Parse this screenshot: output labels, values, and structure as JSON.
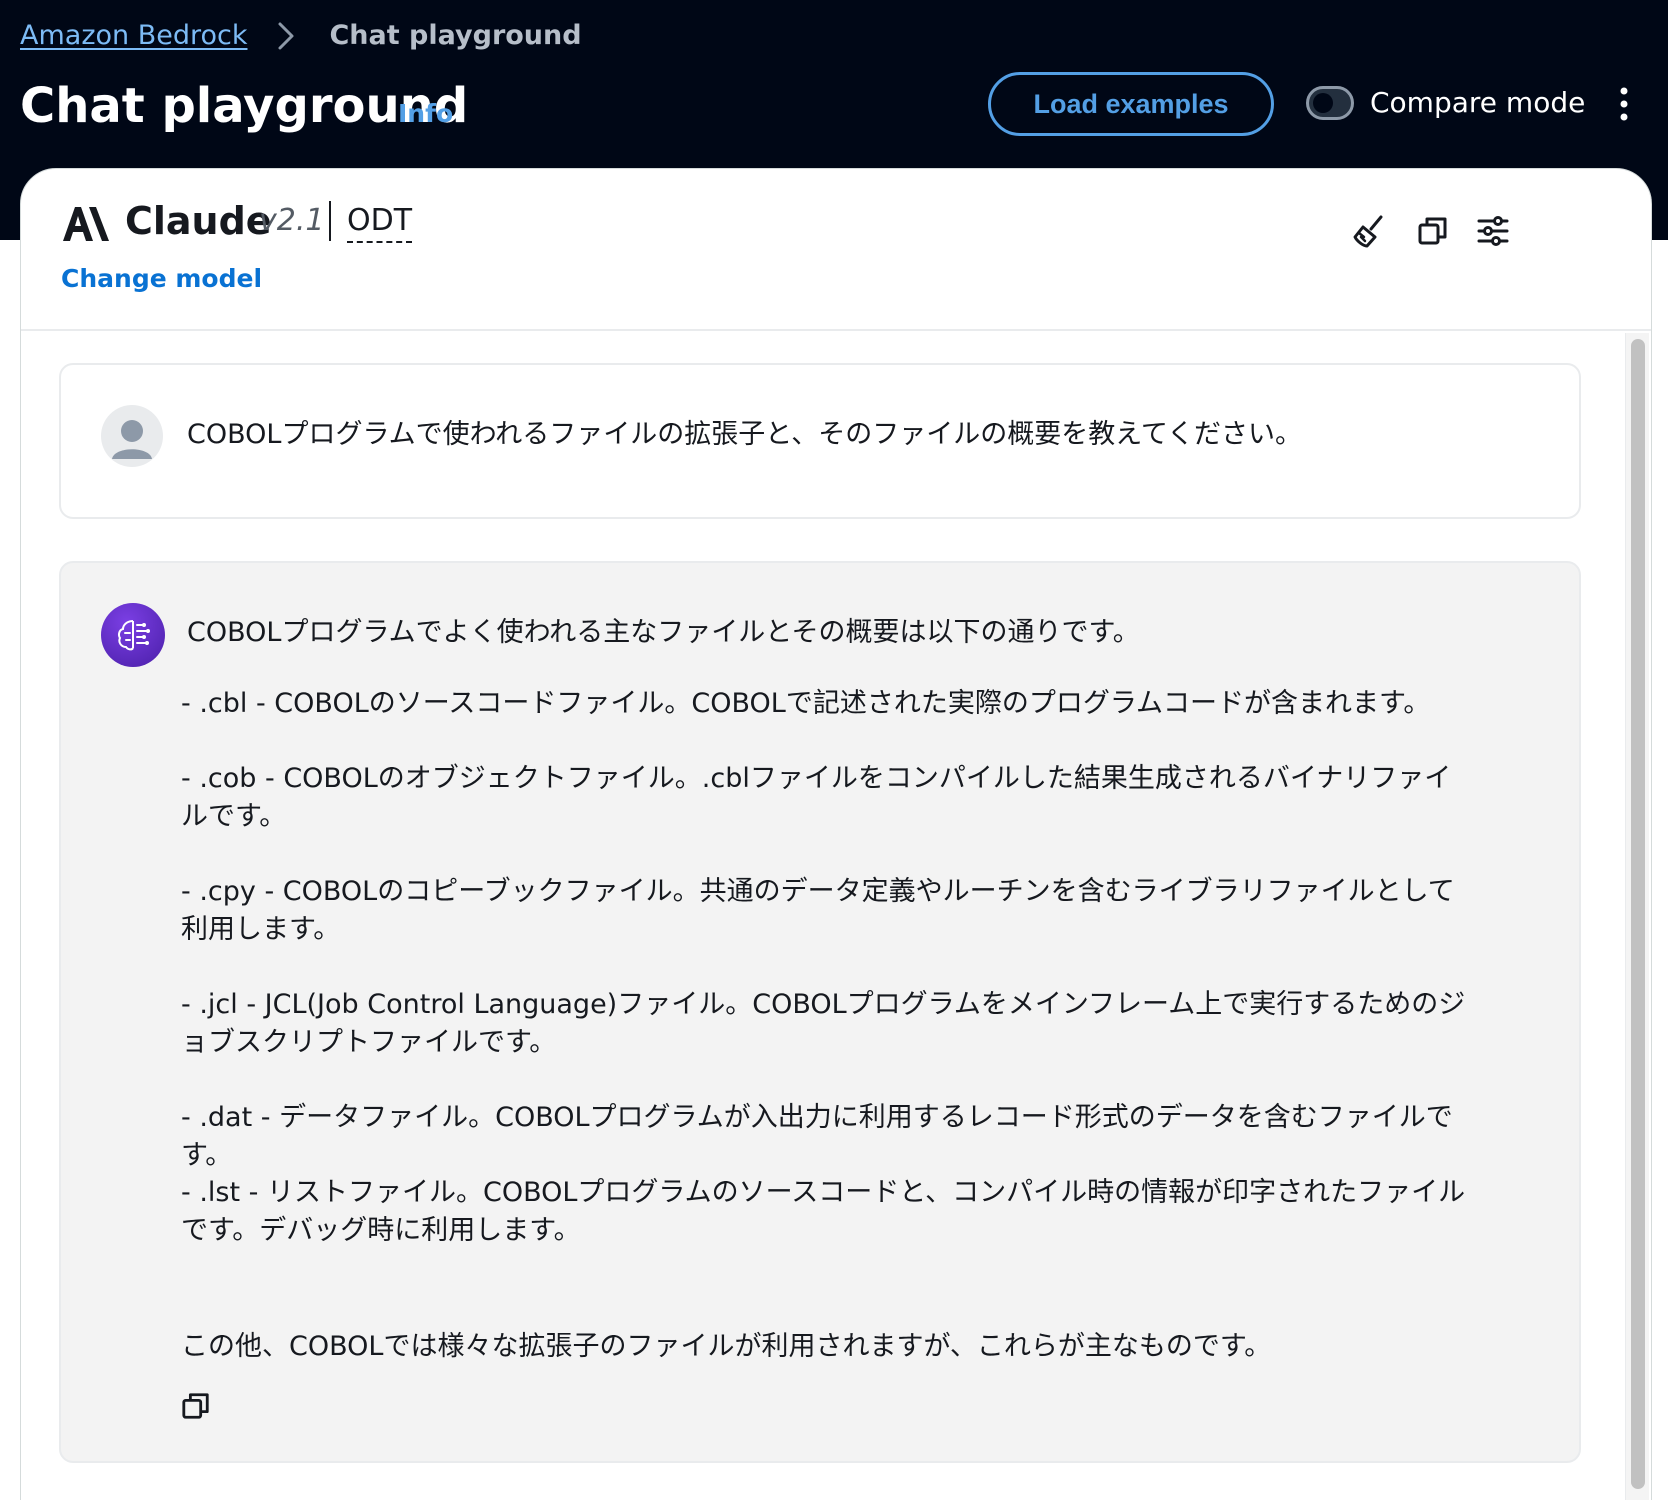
{
  "breadcrumb": {
    "items": [
      {
        "label": "Amazon Bedrock"
      },
      {
        "label": "Chat playground"
      }
    ]
  },
  "header": {
    "title": "Chat playground",
    "info_label": "Info",
    "load_examples_label": "Load examples",
    "compare_mode_label": "Compare mode",
    "compare_mode_on": false
  },
  "model": {
    "name": "Claude",
    "version": "v2.1",
    "mode": "ODT",
    "change_label": "Change model"
  },
  "toolbar": {
    "icons": [
      "clear-chat-icon",
      "copy-icon",
      "settings-sliders-icon"
    ]
  },
  "conversation": {
    "user_message": "COBOLプログラムで使われるファイルの拡張子と、そのファイルの概要を教えてください。",
    "assistant": {
      "intro": "COBOLプログラムでよく使われる主なファイルとその概要は以下の通りです。",
      "items": [
        {
          "text": "- .cbl - COBOLのソースコードファイル。COBOLで記述された実際のプログラムコードが含まれます。"
        },
        {
          "text": "- .cob - COBOLのオブジェクトファイル。.cblファイルをコンパイルした結果生成されるバイナリファイルです。"
        },
        {
          "text": "- .cpy - COBOLのコピーブックファイル。共通のデータ定義やルーチンを含むライブラリファイルとして利用します。"
        },
        {
          "text": "- .jcl - JCL(Job Control Language)ファイル。COBOLプログラムをメインフレーム上で実行するためのジョブスクリプトファイルです。"
        },
        {
          "text": "- .dat - データファイル。COBOLプログラムが入出力に利用するレコード形式のデータを含むファイルです。"
        },
        {
          "text": "- .lst - リストファイル。COBOLプログラムのソースコードと、コンパイル時の情報が印字されたファイルです。デバッグ時に利用します。"
        }
      ],
      "outro": "この他、COBOLでは様々な拡張子のファイルが利用されますが、これらが主なものです。"
    }
  },
  "colors": {
    "header_bg": "#000716",
    "link": "#539fe5",
    "accent_blue": "#0972d3",
    "assistant_bg": "#f3f3f3",
    "ai_avatar": "#5b2bc4"
  }
}
